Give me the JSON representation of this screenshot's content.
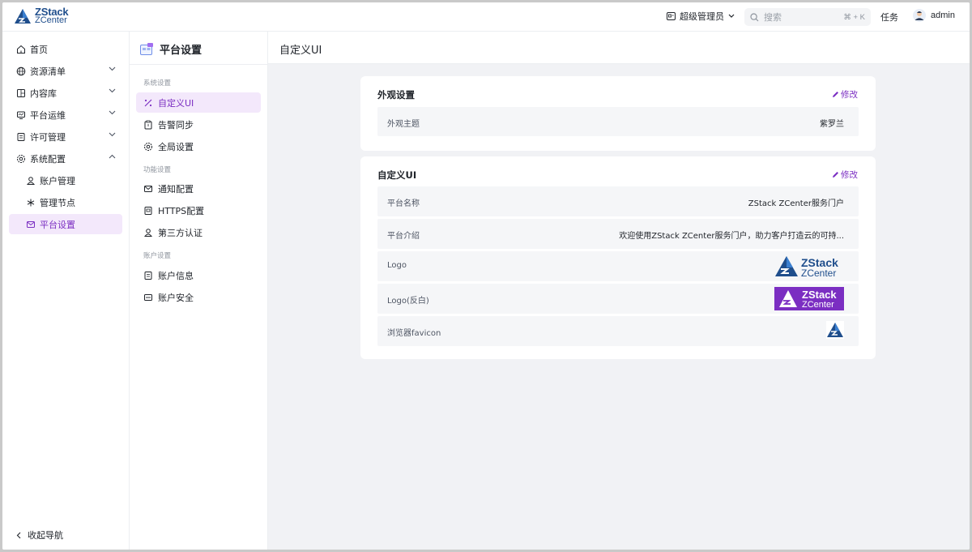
{
  "app": {
    "logo_line1": "ZStack",
    "logo_line2": "ZCenter"
  },
  "topbar": {
    "role_label": "超级管理员",
    "search_placeholder": "搜索",
    "search_shortcut": "⌘ + K",
    "task_label": "任务",
    "username": "admin"
  },
  "sidebar": {
    "items": [
      {
        "label": "首页",
        "icon": "home-icon"
      },
      {
        "label": "资源清单",
        "icon": "globe-icon",
        "expand": "chevron-down"
      },
      {
        "label": "内容库",
        "icon": "library-icon",
        "expand": "chevron-down"
      },
      {
        "label": "平台运维",
        "icon": "monitor-icon",
        "expand": "chevron-down"
      },
      {
        "label": "许可管理",
        "icon": "license-icon",
        "expand": "chevron-down"
      },
      {
        "label": "系统配置",
        "icon": "gear-icon",
        "expand": "chevron-up"
      },
      {
        "label": "账户管理",
        "icon": "user-icon"
      },
      {
        "label": "管理节点",
        "icon": "asterisk-icon"
      },
      {
        "label": "平台设置",
        "icon": "mail-icon",
        "active": true
      }
    ],
    "collapse_label": "收起导航"
  },
  "settings_nav": {
    "title": "平台设置",
    "groups": [
      {
        "label": "系统设置"
      },
      {
        "label": "功能设置"
      },
      {
        "label": "账户设置"
      }
    ],
    "items": [
      {
        "label": "自定义UI",
        "icon": "brush-icon",
        "active": true
      },
      {
        "label": "告警同步",
        "icon": "clipboard-icon"
      },
      {
        "label": "全局设置",
        "icon": "gear-icon"
      },
      {
        "label": "通知配置",
        "icon": "mail-icon"
      },
      {
        "label": "HTTPS配置",
        "icon": "certificate-icon"
      },
      {
        "label": "第三方认证",
        "icon": "user-icon"
      },
      {
        "label": "账户信息",
        "icon": "document-icon"
      },
      {
        "label": "账户安全",
        "icon": "password-icon"
      }
    ]
  },
  "main": {
    "title": "自定义UI",
    "appearance_card": {
      "title": "外观设置",
      "edit_label": "修改",
      "rows": [
        {
          "label": "外观主题",
          "value": "紫罗兰"
        }
      ]
    },
    "custom_ui_card": {
      "title": "自定义UI",
      "edit_label": "修改",
      "rows": [
        {
          "label": "平台名称",
          "value": "ZStack ZCenter服务门户"
        },
        {
          "label": "平台介绍",
          "value": "欢迎使用ZStack ZCenter服务门户，助力客户打造云的可持..."
        },
        {
          "label": "Logo"
        },
        {
          "label": "Logo(反白)"
        },
        {
          "label": "浏览器favicon"
        }
      ]
    }
  },
  "colors": {
    "accent": "#7b2ec2",
    "active_bg": "#f3e8fb",
    "brand": "#1f4e8c"
  }
}
